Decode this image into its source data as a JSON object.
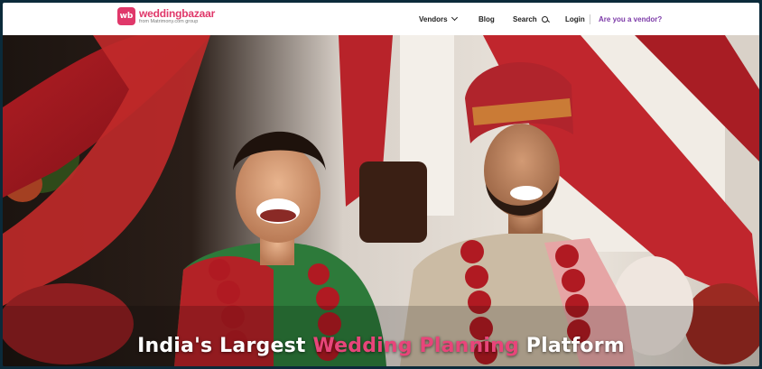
{
  "brand": {
    "mark": "wb",
    "name": "weddingbazaar",
    "tagline": "from Matrimony.com group"
  },
  "nav": {
    "vendors": "Vendors",
    "blog": "Blog",
    "search": "Search",
    "login": "Login",
    "are_you_vendor": "Are you a vendor?"
  },
  "hero": {
    "headline_pre": "India's Largest ",
    "headline_accent": "Wedding Planning",
    "headline_post": " Platform"
  },
  "colors": {
    "brand_pink": "#e0386a",
    "vendor_purple": "#7c3aa8",
    "headline_accent": "#e8457a"
  }
}
